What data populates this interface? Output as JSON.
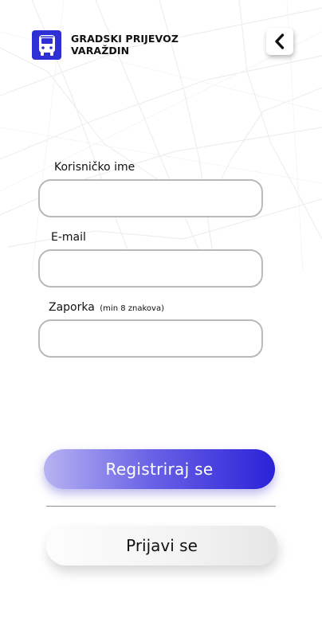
{
  "header": {
    "logo_icon": "bus-icon",
    "title_line1": "GRADSKI PRIJEVOZ",
    "title_line2": "VARAŽDIN",
    "back_icon": "chevron-left-icon"
  },
  "form": {
    "username": {
      "label": "Korisničko ime",
      "value": "",
      "placeholder": ""
    },
    "email": {
      "label": "E-mail",
      "value": "",
      "placeholder": ""
    },
    "password": {
      "label": "Zaporka",
      "hint": "(min 8 znakova)",
      "value": "",
      "placeholder": ""
    }
  },
  "actions": {
    "register_label": "Registriraj se",
    "login_label": "Prijavi se"
  },
  "colors": {
    "brand": "#2f2fd6",
    "register_gradient_start": "#b7b3f2",
    "register_gradient_end": "#2b22d8",
    "input_border": "#b9b9b9",
    "divider": "#8f8f8f"
  }
}
